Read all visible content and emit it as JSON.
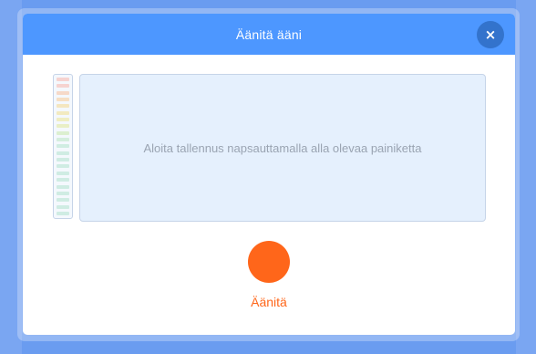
{
  "modal": {
    "title": "Äänitä ääni",
    "close_icon": "×",
    "instruction": "Aloita tallennus napsauttamalla alla olevaa painiketta",
    "record_label": "Äänitä"
  },
  "colors": {
    "header": "#4d97ff",
    "close_button": "#3373cc",
    "record": "#ff661a",
    "waveform_bg": "#e5f0fd"
  },
  "meter": {
    "level": 0,
    "segments": [
      {
        "color": "#f6d3d0"
      },
      {
        "color": "#f6d3d0"
      },
      {
        "color": "#f6d9c8"
      },
      {
        "color": "#f6dfc4"
      },
      {
        "color": "#f4e6c0"
      },
      {
        "color": "#f2eac0"
      },
      {
        "color": "#efeec2"
      },
      {
        "color": "#e9efc6"
      },
      {
        "color": "#dcefd0"
      },
      {
        "color": "#d4eedd"
      },
      {
        "color": "#d0ede2"
      },
      {
        "color": "#cfece3"
      },
      {
        "color": "#cfece3"
      },
      {
        "color": "#cfece3"
      },
      {
        "color": "#cfece3"
      },
      {
        "color": "#cfece3"
      },
      {
        "color": "#cfece3"
      },
      {
        "color": "#cfece3"
      },
      {
        "color": "#cfece3"
      },
      {
        "color": "#cfece3"
      },
      {
        "color": "#cfece3"
      }
    ]
  }
}
